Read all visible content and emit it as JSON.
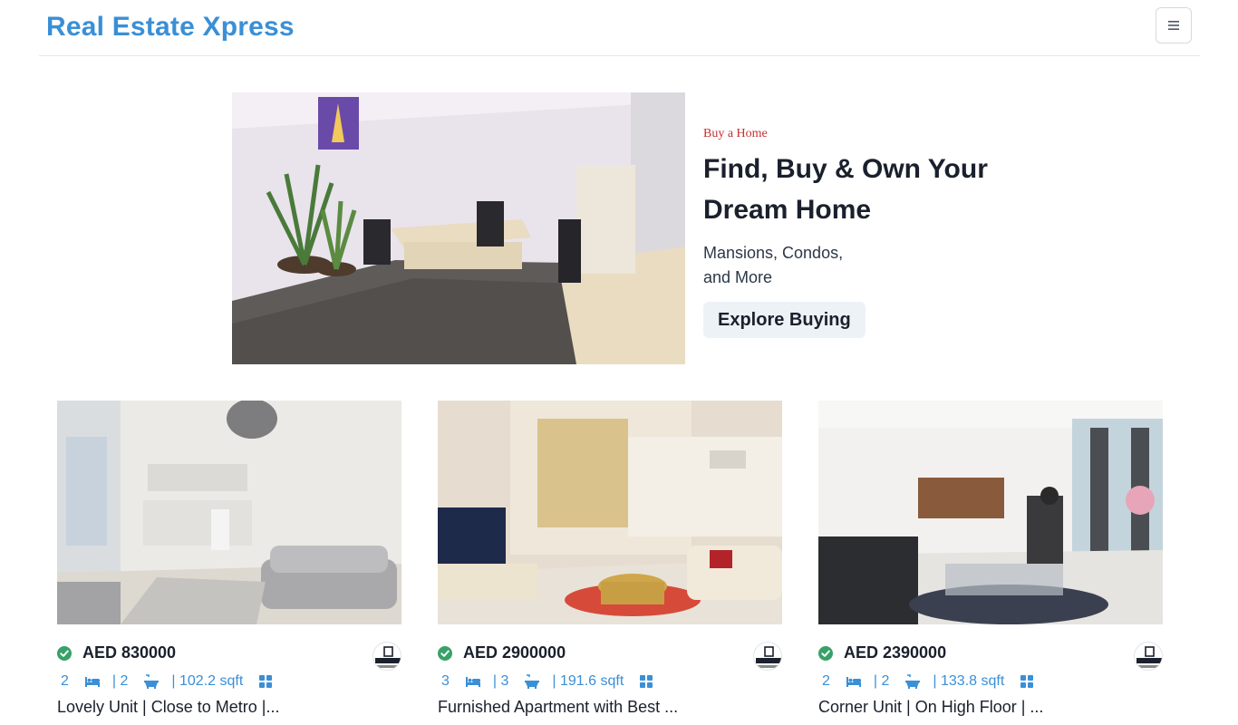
{
  "nav": {
    "brand": "Real Estate Xpress"
  },
  "hero": {
    "eyebrow": "Buy a Home",
    "title": "Find, Buy & Own Your Dream Home",
    "subtitle": "Mansions, Condos, and More",
    "cta": "Explore Buying"
  },
  "listings": [
    {
      "price": "AED 830000",
      "rooms": "2",
      "baths": "| 2",
      "area": "| 102.2 sqft",
      "title": "Lovely Unit | Close to Metro |..."
    },
    {
      "price": "AED 2900000",
      "rooms": "3",
      "baths": "| 3",
      "area": "| 191.6 sqft",
      "title": "Furnished Apartment with Best ..."
    },
    {
      "price": "AED 2390000",
      "rooms": "2",
      "baths": "| 2",
      "area": "| 133.8 sqft",
      "title": "Corner Unit | On High Floor | ..."
    }
  ],
  "colors": {
    "brand": "#3a8fd6",
    "accent": "#c53030",
    "verified": "#38a169"
  },
  "icons": {
    "menu": "hamburger-icon",
    "bed": "bed-icon",
    "bath": "bath-icon",
    "area": "grid-icon",
    "verified": "check-badge-icon"
  }
}
